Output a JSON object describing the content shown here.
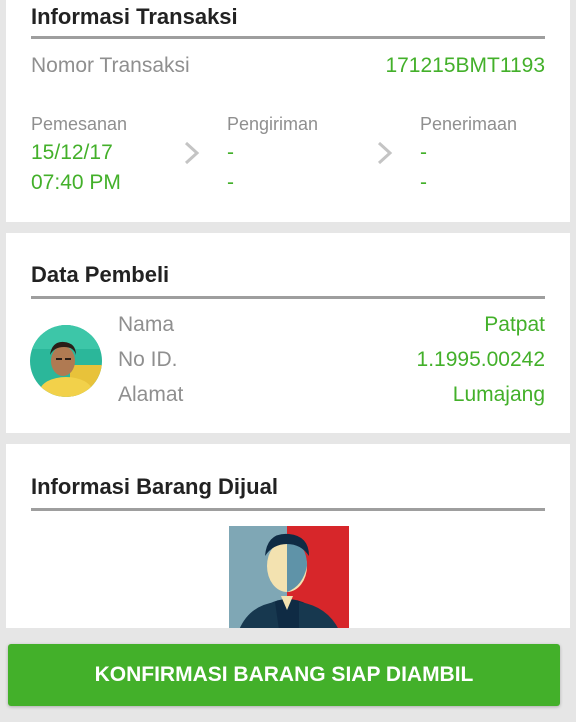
{
  "transaction": {
    "title": "Informasi Transaksi",
    "number_label": "Nomor Transaksi",
    "number_value": "171215BMT1193",
    "steps": [
      {
        "label": "Pemesanan",
        "line1": "15/12/17",
        "line2": "07:40 PM"
      },
      {
        "label": "Pengiriman",
        "line1": "-",
        "line2": "-"
      },
      {
        "label": "Penerimaan",
        "line1": "-",
        "line2": "-"
      }
    ]
  },
  "buyer": {
    "title": "Data Pembeli",
    "rows": [
      {
        "label": "Nama",
        "value": "Patpat"
      },
      {
        "label": "No ID.",
        "value": "1.1995.00242"
      },
      {
        "label": "Alamat",
        "value": "Lumajang"
      }
    ]
  },
  "item": {
    "title": "Informasi Barang Dijual"
  },
  "cta": {
    "label": "KONFIRMASI BARANG SIAP DIAMBIL"
  },
  "colors": {
    "accent": "#43b02a",
    "background": "#e6e6e6",
    "label": "#8f8f8f",
    "divider": "#9e9e9e"
  },
  "icons": [
    "chevron-right-icon",
    "avatar",
    "product-photo"
  ]
}
